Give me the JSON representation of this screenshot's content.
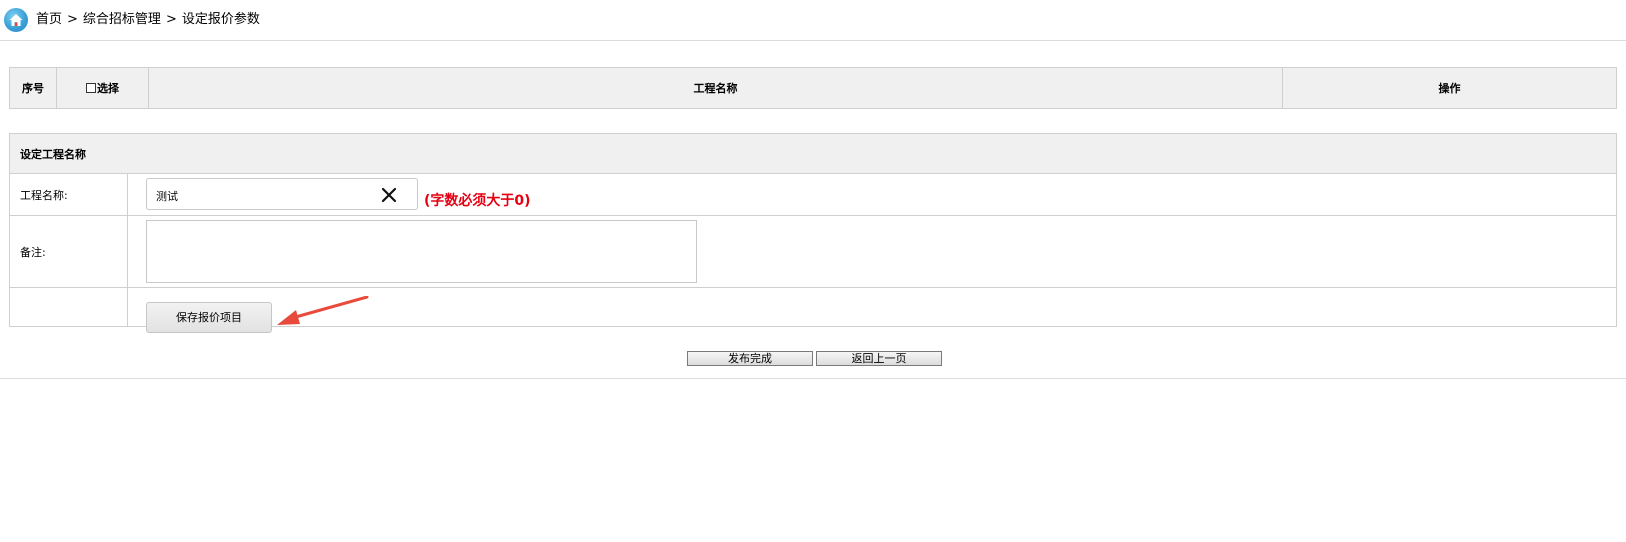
{
  "breadcrumb": {
    "items": [
      "首页",
      "综合招标管理",
      "设定报价参数"
    ],
    "separator": ">"
  },
  "list_table": {
    "headers": {
      "index": "序号",
      "select": "选择",
      "project_name": "工程名称",
      "action": "操作"
    },
    "rows": []
  },
  "form": {
    "section_title": "设定工程名称",
    "project_name_label": "工程名称:",
    "project_name_value": "测试",
    "project_name_hint": "(字数必须大于0)",
    "remark_label": "备注:",
    "remark_value": "",
    "save_label": "保存报价项目"
  },
  "footer": {
    "publish_label": "发布完成",
    "back_label": "返回上一页"
  },
  "colors": {
    "hint": "#e60012",
    "annotation_arrow": "#e84b3c",
    "header_bg": "#f0f0f0",
    "border": "#cfcfcf",
    "home_icon": "#3aa0d8"
  },
  "icons": {
    "home": "home-icon",
    "clear": "close-icon",
    "scroll_up": "chevron-up-icon",
    "scroll_down": "chevron-down-icon",
    "annotation": "arrow-annotation-icon"
  }
}
